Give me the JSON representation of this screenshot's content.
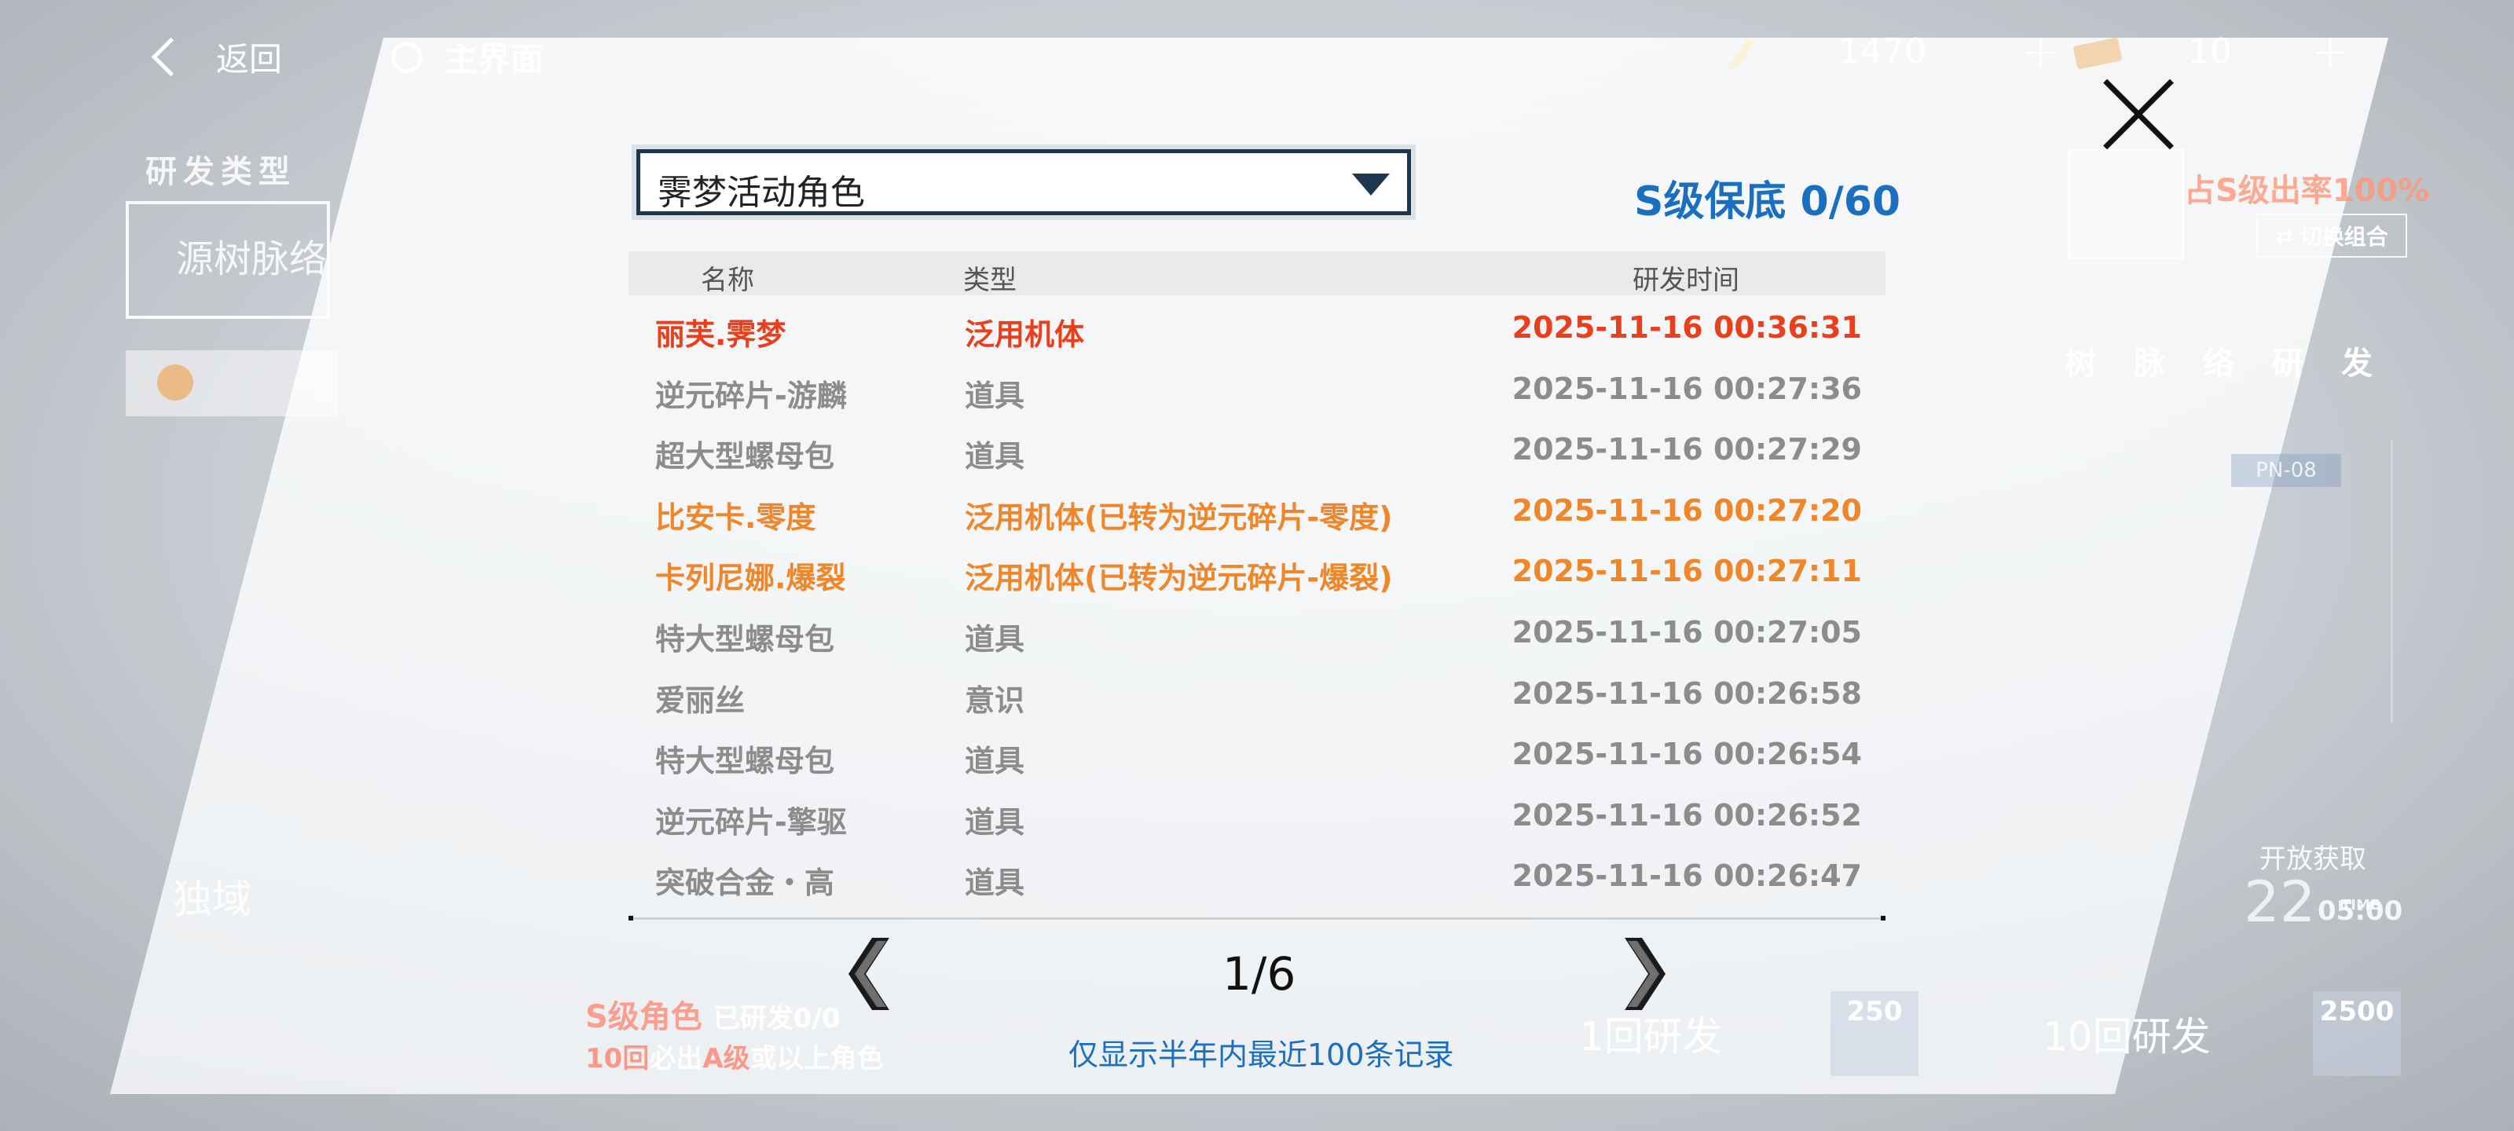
{
  "topbar": {
    "back_label": "返回",
    "home_label": "主界面",
    "resource_1": {
      "icon": "crystal-icon",
      "value": "1470",
      "plus": "+"
    },
    "resource_2": {
      "icon": "ticket-icon",
      "value": "10",
      "plus": "+"
    }
  },
  "background": {
    "type_heading": "研发类型",
    "pool_name": "源树脉络",
    "side_title": "独域",
    "rate_text": "占S级出率100%",
    "switch_label": "切换组合",
    "vertical_label": "树脉络研发",
    "tag": "PN-08",
    "open_text": "开放获取",
    "time_big": "22",
    "time_label": "TIME",
    "time_small": "05:00",
    "s_progress": "S级角色",
    "s_progress_tail": "已研发0/0",
    "guarantee_red": "10回",
    "guarantee_mid": "必出",
    "guarantee_red2": "A级",
    "guarantee_tail": "或以上角色",
    "pull_1_label": "1回研发",
    "pull_1_cost": "250",
    "pull_10_label": "10回研发",
    "pull_10_cost": "2500"
  },
  "dialog": {
    "pool_select": "霁梦活动角色",
    "pity": "S级保底 0/60",
    "columns": {
      "name": "名称",
      "type": "类型",
      "time": "研发时间"
    },
    "rows": [
      {
        "name": "丽芙.霁梦",
        "type": "泛用机体",
        "time": "2025-11-16 00:36:31",
        "color": "#e8401c"
      },
      {
        "name": "逆元碎片-游麟",
        "type": "道具",
        "time": "2025-11-16 00:27:36",
        "color": "#8c8c8c"
      },
      {
        "name": "超大型螺母包",
        "type": "道具",
        "time": "2025-11-16 00:27:29",
        "color": "#8c8c8c"
      },
      {
        "name": "比安卡.零度",
        "type": "泛用机体(已转为逆元碎片-零度)",
        "time": "2025-11-16 00:27:20",
        "color": "#f0862a"
      },
      {
        "name": "卡列尼娜.爆裂",
        "type": "泛用机体(已转为逆元碎片-爆裂)",
        "time": "2025-11-16 00:27:11",
        "color": "#f0862a"
      },
      {
        "name": "特大型螺母包",
        "type": "道具",
        "time": "2025-11-16 00:27:05",
        "color": "#8c8c8c"
      },
      {
        "name": "爱丽丝",
        "type": "意识",
        "time": "2025-11-16 00:26:58",
        "color": "#8c8c8c"
      },
      {
        "name": "特大型螺母包",
        "type": "道具",
        "time": "2025-11-16 00:26:54",
        "color": "#8c8c8c"
      },
      {
        "name": "逆元碎片-擎驱",
        "type": "道具",
        "time": "2025-11-16 00:26:52",
        "color": "#8c8c8c"
      },
      {
        "name": "突破合金・高",
        "type": "道具",
        "time": "2025-11-16 00:26:47",
        "color": "#8c8c8c"
      }
    ],
    "page": "1/6",
    "note": "仅显示半年内最近100条记录"
  }
}
